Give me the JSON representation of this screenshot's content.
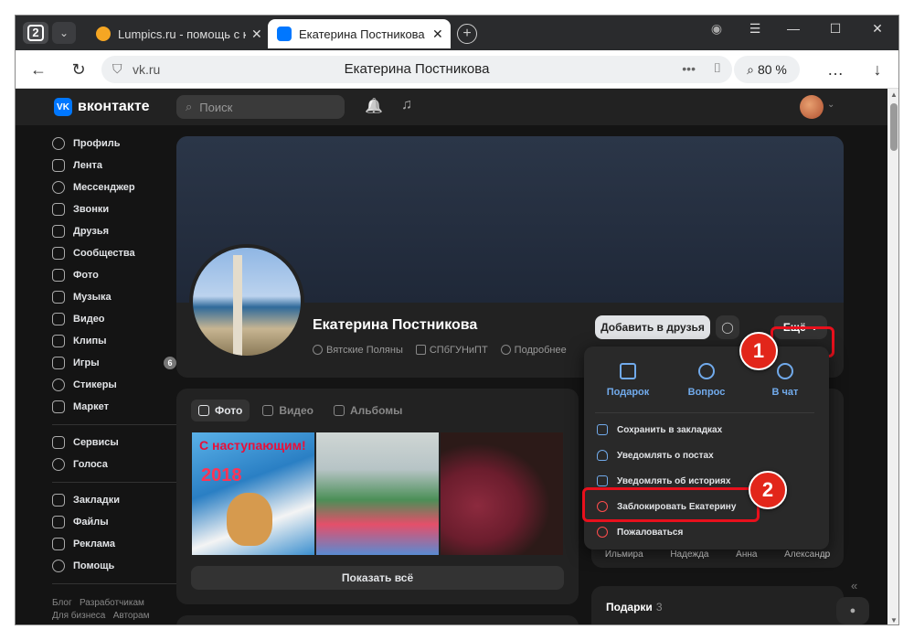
{
  "browser": {
    "tab_count": "2",
    "tabs": [
      {
        "title": "Lumpics.ru - помощь с ко",
        "favicon_color": "#f5a623"
      },
      {
        "title": "Екатерина Постникова",
        "favicon_color": "#0077ff"
      }
    ],
    "address": {
      "host": "vk.ru",
      "page_title": "Екатерина Постникова"
    },
    "zoom": "80 %",
    "icons": {
      "back": "←",
      "reload": "↻",
      "shield": "⛉",
      "more": "•••",
      "bookmark": "⌷",
      "search": "⌕",
      "menu": "…",
      "download": "↓",
      "min": "—",
      "max": "☐",
      "close": "✕",
      "profile": "◉",
      "hamburger": "☰",
      "newtab": "+",
      "tabdd": "⌄",
      "tabclose": "✕"
    }
  },
  "vk": {
    "logo": "вконтакте",
    "logo_mark": "VK",
    "search_placeholder": "Поиск",
    "icons": {
      "bell": "🔔",
      "music": "♫",
      "search": "⌕",
      "chevron": "⌄"
    }
  },
  "sidebar": {
    "group1": [
      "Профиль",
      "Лента",
      "Мессенджер",
      "Звонки",
      "Друзья",
      "Сообщества",
      "Фото",
      "Музыка",
      "Видео",
      "Клипы",
      "Игры",
      "Стикеры",
      "Маркет"
    ],
    "games_badge": "6",
    "group2": [
      "Сервисы",
      "Голоса"
    ],
    "group3": [
      "Закладки",
      "Файлы",
      "Реклама",
      "Помощь"
    ],
    "footer": [
      "Блог",
      "Разработчикам",
      "Для бизнеса",
      "Авторам"
    ]
  },
  "profile": {
    "name": "Екатерина Постникова",
    "city": "Вятские Поляны",
    "university": "СПбГУНиПТ",
    "more_info": "Подробнее",
    "add_friend": "Добавить в друзья",
    "more_button": "Ещё",
    "msg_icon": "◯"
  },
  "photos": {
    "tabs": [
      "Фото",
      "Видео",
      "Альбомы"
    ],
    "thumb1_title": "С наступающим!",
    "thumb1_year": "2018",
    "show_all": "Показать всё"
  },
  "menu": {
    "quick": [
      "Подарок",
      "Вопрос",
      "В чат"
    ],
    "items": [
      "Сохранить в закладках",
      "Уведомлять о постах",
      "Уведомлять об историях",
      "Заблокировать Екатерину",
      "Пожаловаться"
    ]
  },
  "friends": [
    "Ильмира",
    "Надежда",
    "Анна",
    "Александр"
  ],
  "gifts": {
    "title": "Подарки",
    "count": "3"
  },
  "annotations": {
    "step1": "1",
    "step2": "2",
    "highlight_color": "#e8101c"
  },
  "misc": {
    "collapse": "«",
    "chat_fab": "●"
  }
}
